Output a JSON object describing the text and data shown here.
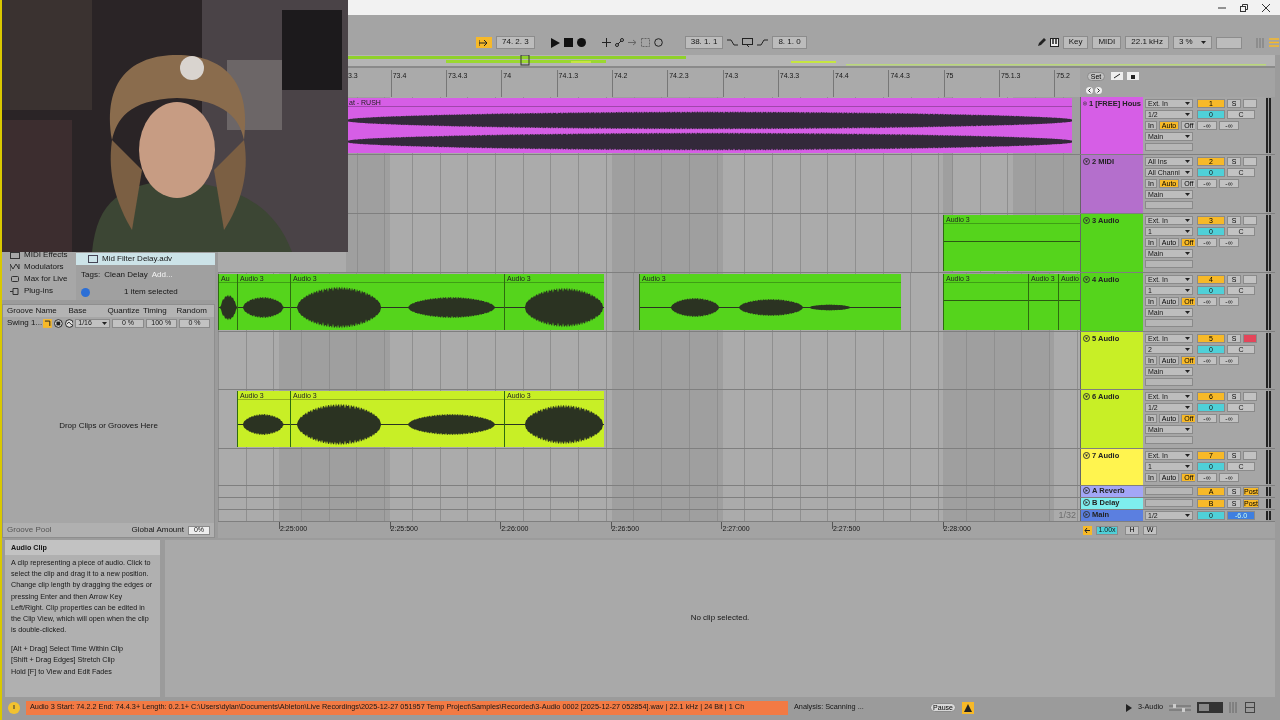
{
  "transport": {
    "follow_on": true,
    "position": "74. 2. 3",
    "loop_start": "38. 1. 1",
    "loop_length": "8. 1. 0"
  },
  "toolbar_right": {
    "key": "Key",
    "midi": "MIDI",
    "sample_rate": "22.1 kHz",
    "cpu": "3 %"
  },
  "browser": {
    "categories": [
      "MIDI Effects",
      "Modulators",
      "Max for Live",
      "Plug-ins"
    ],
    "file": {
      "label": "Mid Filter Delay.adv",
      "selected": true
    },
    "tags_label": "Tags:",
    "tag": "Clean Delay",
    "add_tag": "Add...",
    "selection_count": "1 item selected"
  },
  "groove_pool": {
    "columns": [
      "Groove Name",
      "Base",
      "Quantize",
      "Timing",
      "Random"
    ],
    "rows": [
      {
        "name": "Swing 1...",
        "base": "1/16",
        "quantize": "0 %",
        "timing": "100 %",
        "random": "0 %"
      }
    ],
    "empty_hint": "Drop Clips or Grooves Here",
    "title": "Groove Pool",
    "global_amount_label": "Global Amount",
    "global_amount": "0%"
  },
  "ruler": {
    "bars": [
      "3.3",
      "73.4",
      "73.4.3",
      "74",
      "74.1.3",
      "74.2",
      "74.2.3",
      "74.3",
      "74.3.3",
      "74.4",
      "74.4.3",
      "75",
      "75.1.3",
      "75.2"
    ],
    "set_button": "Set"
  },
  "tracks": [
    {
      "kind": "audio",
      "name": "1 [FREE] Hous",
      "color": "#d65ee6",
      "input": "Ext. In",
      "channel": "1/2",
      "monitor": [
        {
          "label": "In",
          "selected": false
        },
        {
          "label": "Auto",
          "selected": true
        },
        {
          "label": "Off",
          "selected": false
        }
      ],
      "output": "Main",
      "number": "1",
      "solo": "S",
      "armed": false,
      "volume": "0",
      "pan": "C",
      "sends": [
        "-∞",
        "-∞"
      ],
      "clips": [
        {
          "label": "at - RUSH",
          "has_audio": true
        }
      ]
    },
    {
      "kind": "midi",
      "name": "2 MIDI",
      "color": "#b46fcc",
      "input": "All Ins",
      "channel": "All Channi",
      "monitor": [
        {
          "label": "In",
          "selected": false
        },
        {
          "label": "Auto",
          "selected": true
        },
        {
          "label": "Off",
          "selected": false
        }
      ],
      "output": "Main",
      "number": "2",
      "solo": "S",
      "armed": false,
      "volume": "0",
      "pan": "C",
      "sends": [
        "-∞",
        "-∞"
      ]
    },
    {
      "kind": "audio",
      "name": "3 Audio",
      "color": "#55d41c",
      "input": "Ext. In",
      "channel": "1",
      "monitor": [
        {
          "label": "In",
          "selected": false
        },
        {
          "label": "Auto",
          "selected": false
        },
        {
          "label": "Off",
          "selected": true
        }
      ],
      "output": "Main",
      "number": "3",
      "solo": "S",
      "armed": false,
      "volume": "0",
      "pan": "C",
      "sends": [
        "-∞",
        "-∞"
      ],
      "clips": [
        {
          "label": "Audio 3",
          "has_audio": false
        }
      ]
    },
    {
      "kind": "audio",
      "name": "4 Audio",
      "color": "#55d41c",
      "input": "Ext. In",
      "channel": "1",
      "monitor": [
        {
          "label": "In",
          "selected": false
        },
        {
          "label": "Auto",
          "selected": false
        },
        {
          "label": "Off",
          "selected": true
        }
      ],
      "output": "Main",
      "number": "4",
      "solo": "S",
      "armed": false,
      "volume": "0",
      "pan": "C",
      "sends": [
        "-∞",
        "-∞"
      ],
      "clips": [
        {
          "label": "Au",
          "has_audio": true
        },
        {
          "label": "Audio 3",
          "has_audio": true
        },
        {
          "label": "Audio 3",
          "has_audio": true
        },
        {
          "label": "Audio 3",
          "has_audio": true
        },
        {
          "label": "Audio 3",
          "has_audio": true
        },
        {
          "label": "Audio 3",
          "has_audio": false
        },
        {
          "label": "Audio 3",
          "has_audio": false
        },
        {
          "label": "Audio",
          "has_audio": false
        }
      ]
    },
    {
      "kind": "audio",
      "name": "5 Audio",
      "color": "#c8ef26",
      "input": "Ext. In",
      "channel": "2",
      "monitor": [
        {
          "label": "In",
          "selected": false
        },
        {
          "label": "Auto",
          "selected": false
        },
        {
          "label": "Off",
          "selected": true
        }
      ],
      "output": "Main",
      "number": "5",
      "solo": "S",
      "armed": true,
      "volume": "0",
      "pan": "C",
      "sends": [
        "-∞",
        "-∞"
      ]
    },
    {
      "kind": "audio",
      "name": "6 Audio",
      "color": "#c8ef26",
      "input": "Ext. In",
      "channel": "1/2",
      "monitor": [
        {
          "label": "In",
          "selected": false
        },
        {
          "label": "Auto",
          "selected": false
        },
        {
          "label": "Off",
          "selected": true
        }
      ],
      "output": "Main",
      "number": "6",
      "solo": "S",
      "armed": false,
      "volume": "0",
      "pan": "C",
      "sends": [
        "-∞",
        "-∞"
      ],
      "clips": [
        {
          "label": "Audio 3",
          "has_audio": true
        },
        {
          "label": "Audio 3",
          "has_audio": true
        },
        {
          "label": "Audio 3",
          "has_audio": true
        }
      ]
    },
    {
      "kind": "audio",
      "name": "7 Audio",
      "color": "#fff44f",
      "input": "Ext. In",
      "channel": "1",
      "monitor": [
        {
          "label": "In",
          "selected": false
        },
        {
          "label": "Auto",
          "selected": false
        },
        {
          "label": "Off",
          "selected": true
        }
      ],
      "number": "7",
      "solo": "S",
      "armed": false,
      "volume": "0",
      "pan": "C",
      "sends": [
        "-∞",
        "-∞"
      ]
    },
    {
      "kind": "return",
      "name": "A Reverb",
      "color": "#a3a6f7",
      "number": "A",
      "solo": "S",
      "post": "Post"
    },
    {
      "kind": "return",
      "name": "B Delay",
      "color": "#7eeeee",
      "number": "B",
      "solo": "S",
      "post": "Post"
    },
    {
      "kind": "main",
      "name": "Main",
      "color": "#5b7fe0",
      "channel": "1/2",
      "volume": "0",
      "gain": "-6.0"
    }
  ],
  "grid_label": "1/32",
  "time_ruler": [
    "2:25:000",
    "2:25:500",
    "2:26:000",
    "2:26:500",
    "2:27:000",
    "2:27:500",
    "2:28:000"
  ],
  "zoom_controls": {
    "speed": "1.00x",
    "h": "H",
    "w": "W"
  },
  "info_view": {
    "title": "Audio Clip",
    "body": "A clip representing a piece of audio. Click to select the clip and drag it to a new position. Change clip length by dragging the edges or pressing Enter and then Arrow Key Left/Right. Clip properties can be edited in the Clip View, which will open when the clip is double-clicked.",
    "shortcuts": [
      "[Alt + Drag] Select Time Within Clip",
      "[Shift + Drag Edges] Stretch Clip",
      "Hold [F] to View and Edit Fades"
    ]
  },
  "clip_view": {
    "message": "No clip selected."
  },
  "status_bar": {
    "message": "Audio 3 Start: 74.2.2 End: 74.4.3+ Length: 0.2.1+ C:\\Users\\dylan\\Documents\\Ableton\\Live Recordings\\2025-12-27 051957 Temp Project\\Samples\\Recorded\\3-Audio 0002 [2025-12-27 052854].wav | 22.1 kHz | 24 Bit | 1 Ch",
    "analysis": "Analysis: Scanning ...",
    "pause": "Pause",
    "track": "3-Audio"
  },
  "webcam": {
    "kind": "picture"
  }
}
